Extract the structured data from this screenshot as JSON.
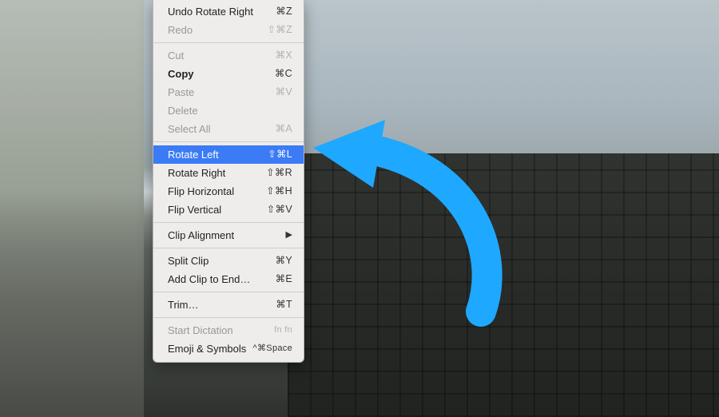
{
  "menu": {
    "items": [
      {
        "label": "Undo Rotate Right",
        "shortcut": "⌘Z",
        "enabled": true
      },
      {
        "label": "Redo",
        "shortcut": "⇧⌘Z",
        "enabled": false
      }
    ],
    "edit_items": [
      {
        "label": "Cut",
        "shortcut": "⌘X",
        "enabled": false
      },
      {
        "label": "Copy",
        "shortcut": "⌘C",
        "enabled": true
      },
      {
        "label": "Paste",
        "shortcut": "⌘V",
        "enabled": false
      },
      {
        "label": "Delete",
        "shortcut": "",
        "enabled": false
      },
      {
        "label": "Select All",
        "shortcut": "⌘A",
        "enabled": false
      }
    ],
    "rotate_items": [
      {
        "label": "Rotate Left",
        "shortcut": "⇧⌘L",
        "enabled": true,
        "selected": true
      },
      {
        "label": "Rotate Right",
        "shortcut": "⇧⌘R",
        "enabled": true
      },
      {
        "label": "Flip Horizontal",
        "shortcut": "⇧⌘H",
        "enabled": true
      },
      {
        "label": "Flip Vertical",
        "shortcut": "⇧⌘V",
        "enabled": true
      }
    ],
    "clip_alignment": {
      "label": "Clip Alignment"
    },
    "clip_items": [
      {
        "label": "Split Clip",
        "shortcut": "⌘Y",
        "enabled": true
      },
      {
        "label": "Add Clip to End…",
        "shortcut": "⌘E",
        "enabled": true
      }
    ],
    "trim": {
      "label": "Trim…",
      "shortcut": "⌘T",
      "enabled": true
    },
    "bottom_items": [
      {
        "label": "Start Dictation",
        "shortcut": "fn fn",
        "enabled": false
      },
      {
        "label": "Emoji & Symbols",
        "shortcut": "^⌘Space",
        "enabled": true
      }
    ]
  },
  "annotation": {
    "color": "#1fa8ff"
  }
}
